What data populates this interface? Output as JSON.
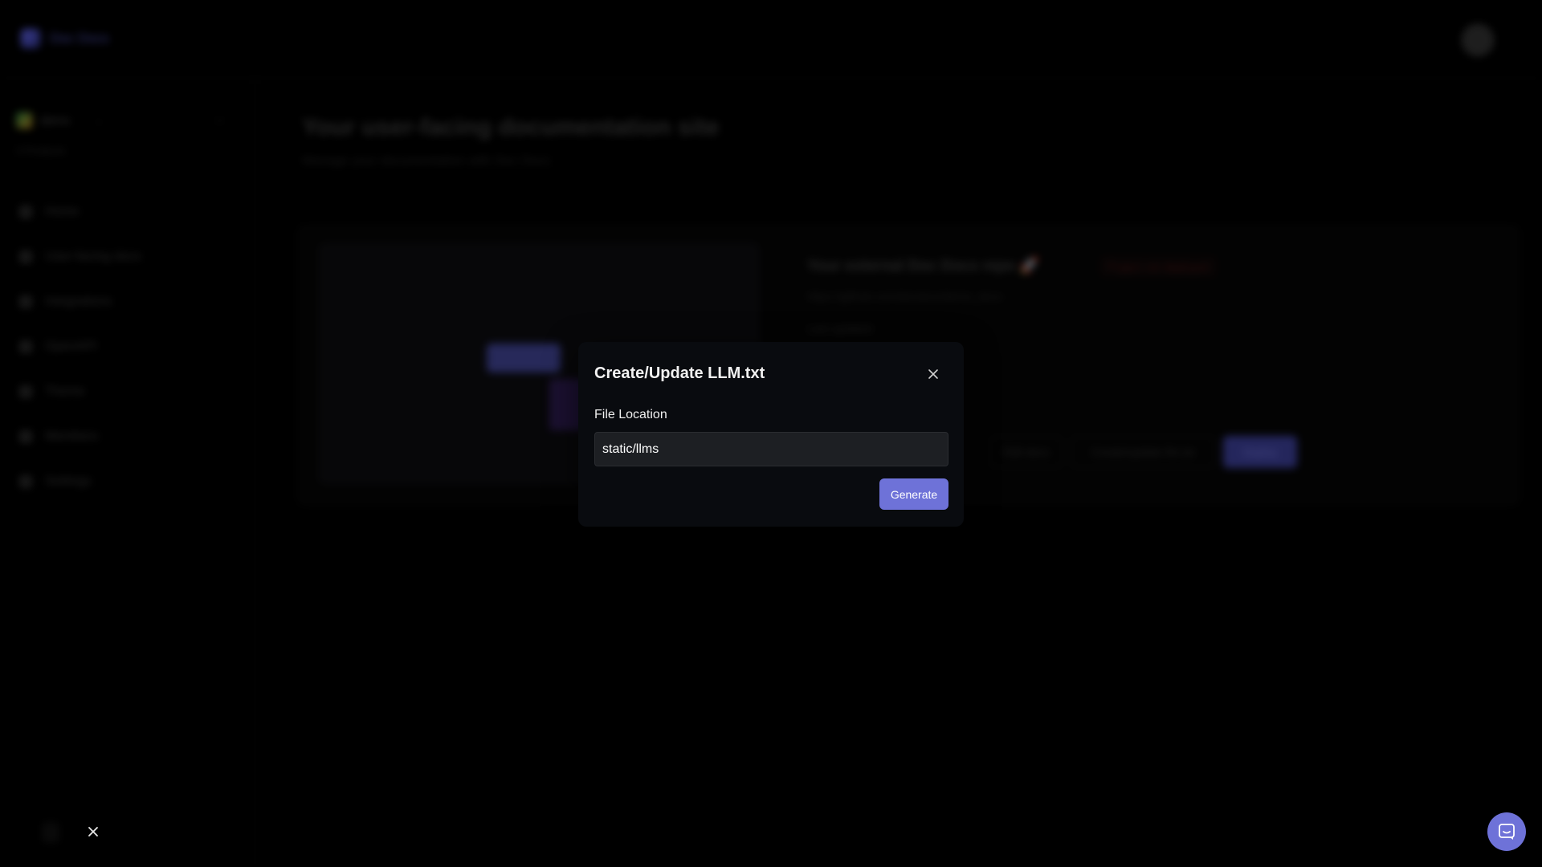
{
  "app": {
    "brand_name": "Doc Docs",
    "workspace_name": "demo",
    "workspace_sub": "0 Products",
    "nav": [
      {
        "label": "Home",
        "icon": "home-icon"
      },
      {
        "label": "User-facing docs",
        "icon": "book-icon"
      },
      {
        "label": "Integrations",
        "icon": "plug-icon"
      },
      {
        "label": "OpenAPI",
        "icon": "api-icon"
      },
      {
        "label": "Theme",
        "icon": "palette-icon"
      },
      {
        "label": "Members",
        "icon": "users-icon"
      },
      {
        "label": "Settings",
        "icon": "gear-icon"
      }
    ]
  },
  "main": {
    "title": "Your user-facing documentation site",
    "subtitle": "Manage your documentation with Doc Docs",
    "card": {
      "repo_title": "Your external Doc Docs repo 🚀",
      "status": "Project not deployed",
      "repo_url": "https://github.com/docdocs/demo_docs",
      "last_updated": "Last updated",
      "btn_a": "Edit docs",
      "btn_b": "Create/update llm.txt",
      "btn_c": "Deploy"
    }
  },
  "modal": {
    "title": "Create/Update LLM.txt",
    "field_label": "File Location",
    "field_value": "static/llms",
    "generate_label": "Generate"
  },
  "colors": {
    "accent": "#6e72d8",
    "modal_bg": "#090b0f",
    "input_bg": "#1d1f23"
  }
}
